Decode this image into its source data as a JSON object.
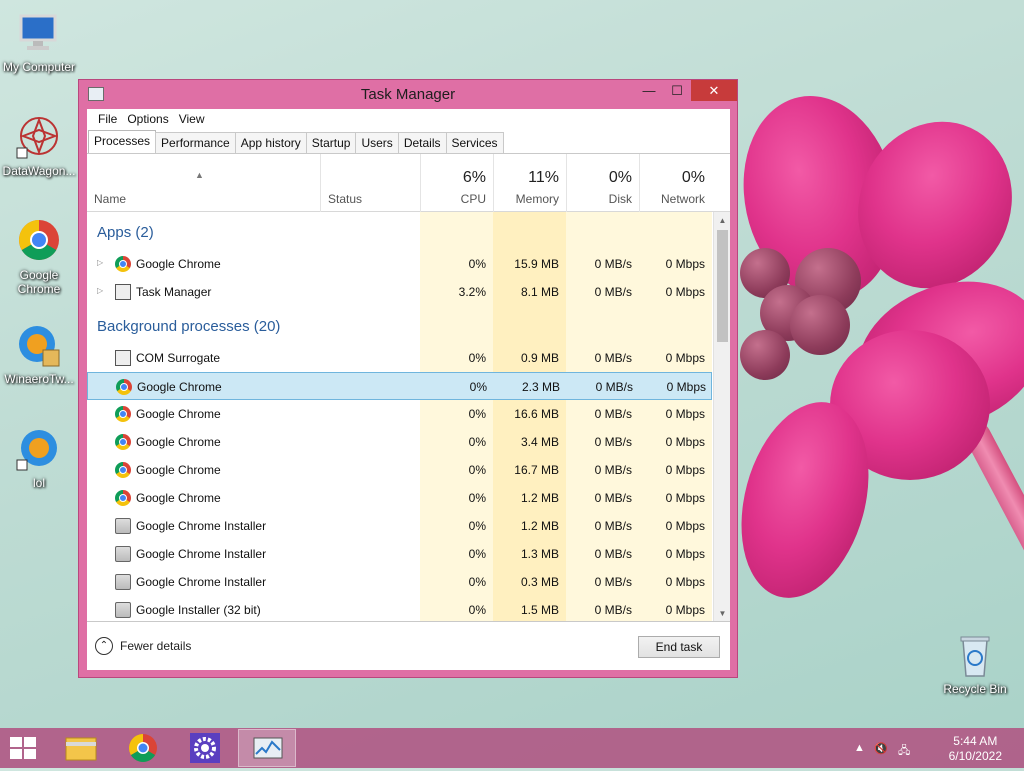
{
  "desktop": {
    "icons": [
      {
        "label": "My Computer"
      },
      {
        "label": "DataWagon..."
      },
      {
        "label": "Google Chrome"
      },
      {
        "label": "WinaeroTw..."
      },
      {
        "label": "lol"
      },
      {
        "label": "Recycle Bin"
      }
    ]
  },
  "window": {
    "title": "Task Manager",
    "controls": {
      "minimize": "—",
      "maximize": "☐",
      "close": "✕"
    },
    "menu": [
      "File",
      "Options",
      "View"
    ],
    "tabs": [
      "Processes",
      "Performance",
      "App history",
      "Startup",
      "Users",
      "Details",
      "Services"
    ],
    "active_tab": "Processes",
    "columns": {
      "name": "Name",
      "status": "Status",
      "cpu": {
        "pct": "6%",
        "label": "CPU"
      },
      "memory": {
        "pct": "11%",
        "label": "Memory"
      },
      "disk": {
        "pct": "0%",
        "label": "Disk"
      },
      "network": {
        "pct": "0%",
        "label": "Network"
      }
    },
    "groups": {
      "apps": "Apps (2)",
      "background": "Background processes (20)"
    },
    "apps": [
      {
        "name": "Google Chrome",
        "icon": "chrome-icon",
        "cpu": "0%",
        "memory": "15.9 MB",
        "disk": "0 MB/s",
        "network": "0 Mbps"
      },
      {
        "name": "Task Manager",
        "icon": "task-manager-icon",
        "cpu": "3.2%",
        "memory": "8.1 MB",
        "disk": "0 MB/s",
        "network": "0 Mbps"
      }
    ],
    "background": [
      {
        "name": "COM Surrogate",
        "icon": "com-surrogate-icon",
        "cpu": "0%",
        "memory": "0.9 MB",
        "disk": "0 MB/s",
        "network": "0 Mbps"
      },
      {
        "name": "Google Chrome",
        "icon": "chrome-icon",
        "cpu": "0%",
        "memory": "2.3 MB",
        "disk": "0 MB/s",
        "network": "0 Mbps",
        "selected": true
      },
      {
        "name": "Google Chrome",
        "icon": "chrome-icon",
        "cpu": "0%",
        "memory": "16.6 MB",
        "disk": "0 MB/s",
        "network": "0 Mbps"
      },
      {
        "name": "Google Chrome",
        "icon": "chrome-icon",
        "cpu": "0%",
        "memory": "3.4 MB",
        "disk": "0 MB/s",
        "network": "0 Mbps"
      },
      {
        "name": "Google Chrome",
        "icon": "chrome-icon",
        "cpu": "0%",
        "memory": "16.7 MB",
        "disk": "0 MB/s",
        "network": "0 Mbps"
      },
      {
        "name": "Google Chrome",
        "icon": "chrome-icon",
        "cpu": "0%",
        "memory": "1.2 MB",
        "disk": "0 MB/s",
        "network": "0 Mbps"
      },
      {
        "name": "Google Chrome Installer",
        "icon": "installer-icon",
        "cpu": "0%",
        "memory": "1.2 MB",
        "disk": "0 MB/s",
        "network": "0 Mbps"
      },
      {
        "name": "Google Chrome Installer",
        "icon": "installer-icon",
        "cpu": "0%",
        "memory": "1.3 MB",
        "disk": "0 MB/s",
        "network": "0 Mbps"
      },
      {
        "name": "Google Chrome Installer",
        "icon": "installer-icon",
        "cpu": "0%",
        "memory": "0.3 MB",
        "disk": "0 MB/s",
        "network": "0 Mbps"
      },
      {
        "name": "Google Installer (32 bit)",
        "icon": "installer-icon",
        "cpu": "0%",
        "memory": "1.5 MB",
        "disk": "0 MB/s",
        "network": "0 Mbps"
      }
    ],
    "footer": {
      "fewer_details": "Fewer details",
      "end_task": "End task"
    }
  },
  "taskbar": {
    "time": "5:44 AM",
    "date": "6/10/2022",
    "pinned": [
      "file-explorer-icon",
      "chrome-icon",
      "settings-icon",
      "task-manager-icon"
    ],
    "active": "task-manager-icon"
  },
  "colors": {
    "window_frame": "#df6fa5",
    "selected_row": "#cce8f5",
    "group_heading": "#2a5d9b",
    "heat_light": "#fff8dc",
    "heat_medium": "#fff0c0",
    "taskbar": "#b05080"
  }
}
